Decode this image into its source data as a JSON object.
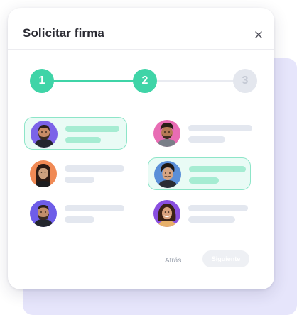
{
  "modal": {
    "title": "Solicitar firma",
    "close_icon": "close-icon"
  },
  "stepper": {
    "steps": [
      {
        "label": "1",
        "state": "completed"
      },
      {
        "label": "2",
        "state": "current"
      },
      {
        "label": "3",
        "state": "upcoming"
      }
    ],
    "colors": {
      "active": "#3fd4a7",
      "inactive": "#e4e7ee"
    }
  },
  "people": [
    {
      "selected": true,
      "avatar": "man-beard-dark-hair"
    },
    {
      "selected": false,
      "avatar": "man-curly-hair-beard"
    },
    {
      "selected": false,
      "avatar": "woman-long-hair"
    },
    {
      "selected": true,
      "avatar": "man-curly-hair-mustache"
    },
    {
      "selected": false,
      "avatar": "man-beard-short-hair"
    },
    {
      "selected": false,
      "avatar": "woman-curly-hair-smiling"
    }
  ],
  "footer": {
    "back_label": "Atrás",
    "next_label": "Siguiente"
  },
  "colors": {
    "accent": "#3fd4a7",
    "selected_bg": "#e9fbf5",
    "background_card": "#e6e5fb"
  }
}
